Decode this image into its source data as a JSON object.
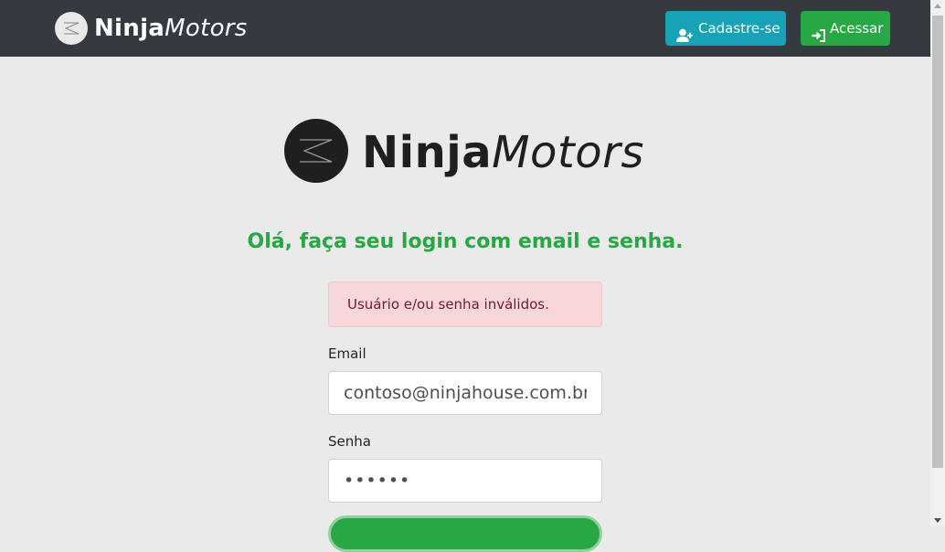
{
  "navbar": {
    "brand_bold": "Ninja",
    "brand_italic": "Motors",
    "signup_label": "Cadastre-se",
    "login_label": "Acessar",
    "signup_color": "#17a2b8",
    "login_color": "#28a745",
    "background": "#343a40"
  },
  "hero": {
    "brand_bold": "Ninja",
    "brand_italic": "Motors"
  },
  "login": {
    "subtitle": "Olá, faça seu login com email e senha.",
    "error_message": "Usuário e/ou senha inválidos.",
    "email_label": "Email",
    "email_value": "contoso@ninjahouse.com.br",
    "password_label": "Senha",
    "password_value": "••••••"
  },
  "icons": {
    "signup": "user-plus-icon",
    "login": "sign-in-icon"
  }
}
